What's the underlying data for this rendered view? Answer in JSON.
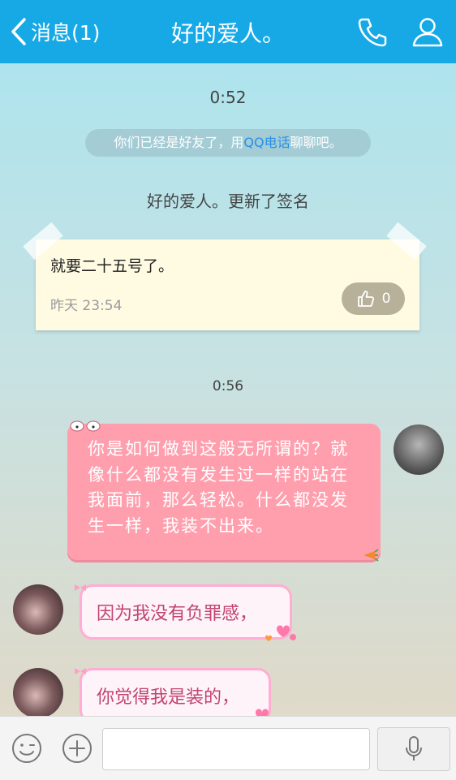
{
  "header": {
    "back_label": "消息(1)",
    "title": "好的爱人。",
    "call_icon": "phone-icon",
    "profile_icon": "user-icon",
    "color": "#16a9e6"
  },
  "chat": {
    "time_1": "0:52",
    "notice": {
      "prefix": "你们已经是好友了，用",
      "link": "QQ电话",
      "suffix": "聊聊吧。"
    },
    "signature_update": "好的爱人。更新了签名",
    "signature_card": {
      "text": "就要二十五号了。",
      "time": "昨天 23:54",
      "likes": "0"
    },
    "time_2": "0:56",
    "messages": [
      {
        "side": "right",
        "text": "你是如何做到这般无所谓的？就像什么都没有发生过一样的站在我面前，那么轻松。什么都没发生一样，我装不出来。",
        "bubble_color": "#ff9fae"
      },
      {
        "side": "left",
        "text": "因为我没有负罪感，",
        "bubble_color": "#fff3fa"
      },
      {
        "side": "left",
        "text": "你觉得我是装的，",
        "bubble_color": "#fff3fa"
      }
    ]
  },
  "input_bar": {
    "emoji_icon": "smiley-icon",
    "plus_icon": "plus-icon",
    "mic_icon": "microphone-icon"
  }
}
